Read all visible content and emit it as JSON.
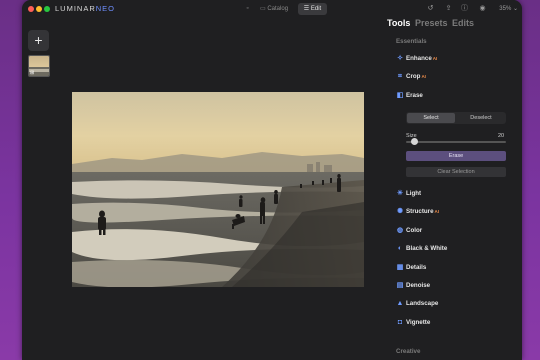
{
  "window": {
    "title": "LUMINAR",
    "title_accent": "NEO"
  },
  "toolbar": {
    "catalog_label": "Catalog",
    "edit_label": "Edit",
    "zoom": "35%",
    "icons": [
      "undo-icon",
      "share-icon",
      "info-icon",
      "eye-icon"
    ]
  },
  "colors": {
    "accent": "#6f9bff",
    "ai_badge": "#e98a4a",
    "brand_neo": "#6f8fff"
  },
  "sidebar": {
    "add_label": "+"
  },
  "panel": {
    "tabs": [
      {
        "label": "Tools",
        "active": true
      },
      {
        "label": "Presets",
        "active": false
      },
      {
        "label": "Edits",
        "active": false
      }
    ],
    "sections": {
      "essentials": "Essentials",
      "creative": "Creative"
    },
    "tools": [
      {
        "label": "Enhance",
        "ai": true,
        "icon": "enhance-icon"
      },
      {
        "label": "Crop",
        "ai": true,
        "icon": "crop-icon"
      },
      {
        "label": "Erase",
        "ai": false,
        "icon": "erase-icon",
        "expanded": true
      },
      {
        "label": "Light",
        "ai": false,
        "icon": "sun-icon"
      },
      {
        "label": "Structure",
        "ai": true,
        "icon": "structure-icon"
      },
      {
        "label": "Color",
        "ai": false,
        "icon": "color-icon"
      },
      {
        "label": "Black & White",
        "ai": false,
        "icon": "black-white-icon"
      },
      {
        "label": "Details",
        "ai": false,
        "icon": "details-icon"
      },
      {
        "label": "Denoise",
        "ai": false,
        "icon": "denoise-icon"
      },
      {
        "label": "Landscape",
        "ai": false,
        "icon": "landscape-icon"
      },
      {
        "label": "Vignette",
        "ai": false,
        "icon": "vignette-icon"
      }
    ],
    "ai_mark": "AI",
    "erase": {
      "select_label": "Select",
      "deselect_label": "Deselect",
      "size_label": "Size",
      "size_value": "20",
      "size_fraction": 0.08,
      "erase_button": "Erase",
      "clear_button": "Clear Selection"
    }
  }
}
